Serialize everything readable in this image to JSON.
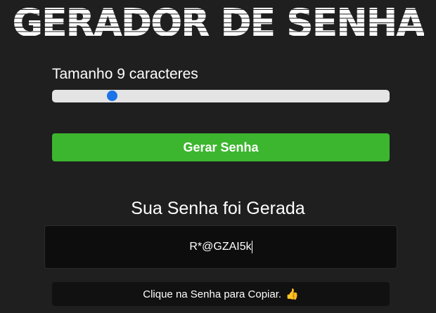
{
  "header": {
    "logo_text": "GERADOR DE SENHA"
  },
  "length": {
    "prefix": "Tamanho",
    "value": "9",
    "suffix": "caracteres",
    "slider_min": 1,
    "slider_max": 50,
    "slider_value": 9,
    "accent_color": "#1a73e8"
  },
  "generate_button": {
    "label": "Gerar Senha",
    "color": "#3cb62f"
  },
  "result": {
    "title": "Sua Senha foi Gerada",
    "password": "R*@GZAI5k",
    "copy_hint": "Clique na Senha para Copiar.",
    "copy_hint_icon": "thumbs-up-icon"
  }
}
